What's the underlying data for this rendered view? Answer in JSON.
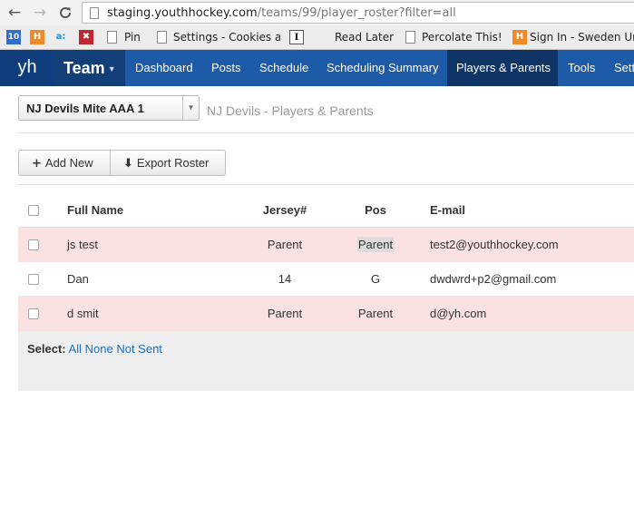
{
  "browser": {
    "url_host": "staging.youthhockey.com",
    "url_path": "/teams/99/player_roster?filter=all",
    "nav_back": "←",
    "nav_forward": "→",
    "nav_reload": "C",
    "bookmarks": [
      {
        "icon_text": "10",
        "icon_color": "#2f6fd1",
        "label": ""
      },
      {
        "icon_text": "H",
        "icon_color": "#f08a24",
        "label": ""
      },
      {
        "icon_text": "a:",
        "icon_color": "#ececec",
        "label": ""
      },
      {
        "icon_text": "✖",
        "icon_color": "#c0282e",
        "label": ""
      },
      {
        "icon_text": "",
        "icon_color": "",
        "label": "Pin"
      },
      {
        "icon_text": "",
        "icon_color": "",
        "label": "Settings - Cookies a"
      },
      {
        "icon_text": "I",
        "icon_color": "#ffffff",
        "label": "Read Later"
      },
      {
        "icon_text": "",
        "icon_color": "",
        "label": "Percolate This!"
      },
      {
        "icon_text": "H",
        "icon_color": "#f08a24",
        "label": "Sign In - Sweden Uni"
      }
    ]
  },
  "app": {
    "logo": "yh",
    "team_menu": "Team",
    "nav": [
      "Dashboard",
      "Posts",
      "Schedule",
      "Scheduling Summary",
      "Players & Parents",
      "Tools",
      "Setti"
    ],
    "active_nav": "Players & Parents",
    "brand_color": "#1d5ba8"
  },
  "roster": {
    "team_select": "NJ Devils Mite AAA 1",
    "subtitle": "NJ Devils - Players & Parents",
    "add_button": "Add New",
    "export_button": "Export Roster",
    "columns": {
      "name": "Full Name",
      "jersey": "Jersey#",
      "pos": "Pos",
      "email": "E-mail"
    },
    "rows": [
      {
        "name": "js test",
        "jersey": "Parent",
        "pos": "Parent",
        "email": "test2@youthhockey.com",
        "highlight": true
      },
      {
        "name": "Dan",
        "jersey": "14",
        "pos": "G",
        "email": "dwdwrd+p2@gmail.com",
        "highlight": false
      },
      {
        "name": "d smit",
        "jersey": "Parent",
        "pos": "Parent",
        "email": "d@yh.com",
        "highlight": true
      }
    ],
    "select_label": "Select:",
    "select_all": "All",
    "select_none": "None",
    "select_not_sent": "Not Sent"
  }
}
